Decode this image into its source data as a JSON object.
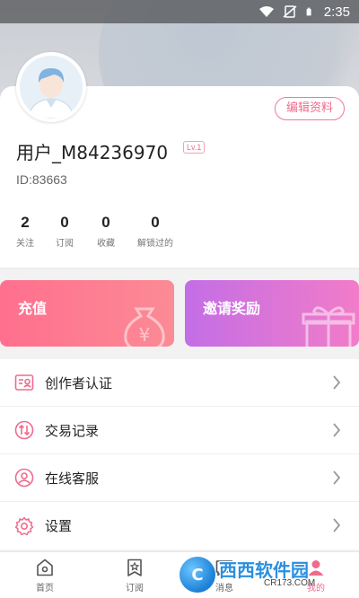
{
  "status_bar": {
    "time": "2:35"
  },
  "profile": {
    "edit_label": "编辑资料",
    "username": "用户_M84236970",
    "level": "Lv.1",
    "user_id": "ID:83663",
    "stats": [
      {
        "value": "2",
        "label": "关注"
      },
      {
        "value": "0",
        "label": "订阅"
      },
      {
        "value": "0",
        "label": "收藏"
      },
      {
        "value": "0",
        "label": "解锁过的"
      }
    ]
  },
  "banners": {
    "recharge": "充值",
    "invite": "邀请奖励"
  },
  "menu": [
    {
      "label": "创作者认证",
      "icon": "creator-verify-icon"
    },
    {
      "label": "交易记录",
      "icon": "transaction-icon"
    },
    {
      "label": "在线客服",
      "icon": "customer-service-icon"
    },
    {
      "label": "设置",
      "icon": "settings-icon"
    }
  ],
  "tabs": [
    {
      "label": "首页",
      "icon": "home-icon"
    },
    {
      "label": "订阅",
      "icon": "subscribe-icon"
    },
    {
      "label": "消息",
      "icon": "message-icon"
    },
    {
      "label": "我的",
      "icon": "profile-icon"
    }
  ],
  "watermark": {
    "brand": "西西软件园",
    "site": "CR173.COM"
  },
  "colors": {
    "accent": "#ef6b8e",
    "recharge_gradient": [
      "#ff6f8e",
      "#fb8b95"
    ],
    "invite_gradient": [
      "#c36ee6",
      "#f27cc8"
    ]
  }
}
